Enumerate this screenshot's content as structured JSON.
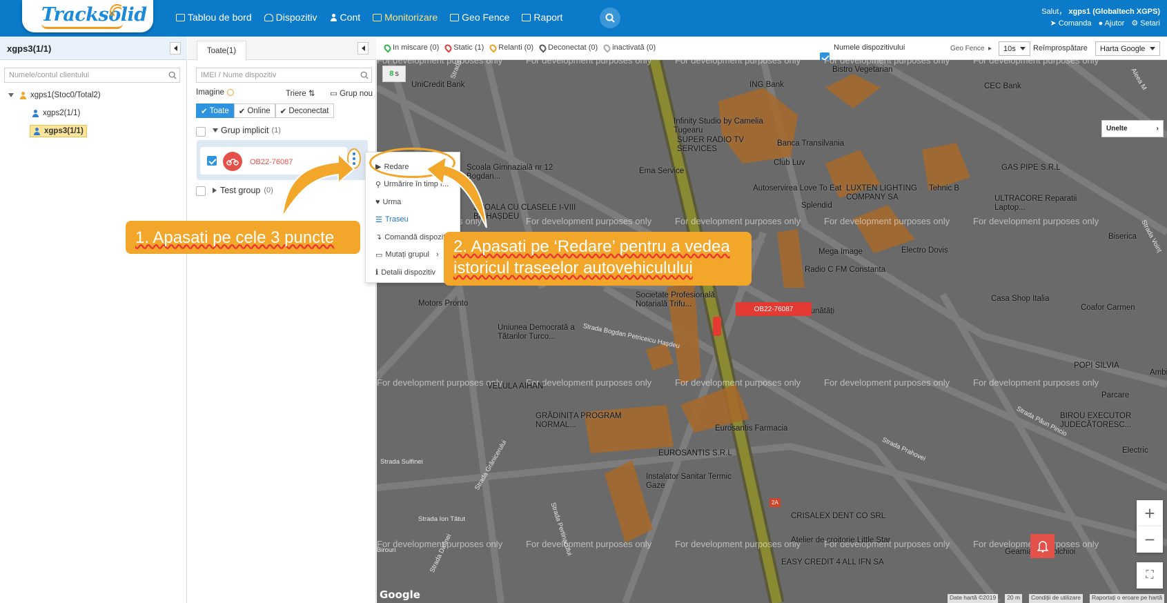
{
  "header": {
    "logo_text": "Tracksolid",
    "nav": [
      {
        "label": "Tablou de bord",
        "icon": "dashboard-icon"
      },
      {
        "label": "Dispozitiv",
        "icon": "device-icon"
      },
      {
        "label": "Cont",
        "icon": "account-icon"
      },
      {
        "label": "Monitorizare",
        "icon": "map-icon",
        "active": true
      },
      {
        "label": "Geo Fence",
        "icon": "geofence-icon"
      },
      {
        "label": "Raport",
        "icon": "report-icon"
      }
    ],
    "greeting": "Salut，",
    "user": "xgps1 (Globaltech XGPS)",
    "links": [
      "Comanda",
      "Ajutor",
      "Setari"
    ]
  },
  "left_panel": {
    "title": "xgps3(1/1)",
    "search_placeholder": "Numele/contul clientului",
    "tree": [
      "xgps1(Stoc0/Total2)",
      "xgps2(1/1)",
      "xgps3(1/1)"
    ]
  },
  "device_panel": {
    "tab": "Toate(1)",
    "search_placeholder": "IMEI / Nume dispozitiv",
    "image_label": "Imagine",
    "sort_label": "Triere",
    "new_group": "Grup nou",
    "filters": [
      "Toate",
      "Online",
      "Deconectat"
    ],
    "groups": [
      {
        "name": "Grup implicit",
        "count": "(1)"
      },
      {
        "name": "Test group",
        "count": "(0)"
      }
    ],
    "device_name": "OB22-76087"
  },
  "context_menu": [
    "Redare",
    "Urmărire în timp r...",
    "Urma",
    "Traseu",
    "Comandă dispoziti",
    "Mutați grupul",
    "Detalii dispozitiv"
  ],
  "map_top": {
    "statuses": [
      {
        "label": "In miscare (0)",
        "color": "#2fb54a"
      },
      {
        "label": "Static (1)",
        "color": "#e33a33"
      },
      {
        "label": "Relanti (0)",
        "color": "#f0a020"
      },
      {
        "label": "Deconectat (0)",
        "color": "#555555"
      },
      {
        "label": "inactivată (0)",
        "color": "#aaaaaa"
      }
    ],
    "device_names_label": "Numele dispozitivului",
    "geofence_label": "Geo Fence",
    "refresh_value": "10s",
    "refresh_label": "Reîmprospătare",
    "map_type": "Harta Google"
  },
  "map": {
    "timer": "8",
    "timer_unit": "s",
    "tools": "Unelte",
    "watermark": "For development purposes only",
    "device_label": "OB22-76087",
    "places": [
      "UniCredit Bank",
      "ING Bank",
      "CEC Bank",
      "Bistro Vegetarian",
      "Infinity Studio by Camelia Tugearu",
      "SUPER RADIO TV SERVICES",
      "Banca Transilvania",
      "Club Luv",
      "Ema Service",
      "Autoservirea Love To Eat",
      "Splendid",
      "LUXTEN LIGHTING COMPANY SA",
      "Tehnic B",
      "GAS PIPE S.R.L",
      "ULTRACORE Reparatii Laptop...",
      "Biserica",
      "Școala Gimnazială nr 12 Bogdan...",
      "ȘCOALA CU CLASELE I-VIII BP HAȘDEU",
      "Mega Image",
      "Electro Dovis",
      "Radio C FM Constanta",
      "Societate Profesională Notarială Trifu...",
      "Vitrina cu Bunătăți",
      "Casa Shop Italia",
      "Coafor Carmen",
      "Motors Pronto",
      "Uniunea Democrată a Tătarilor Turco...",
      "POPI SILVIA",
      "VELULA AIHAN",
      "Parcare",
      "GRĂDINIȚA PROGRAM NORMAL...",
      "Eurosantis Farmacia",
      "BIROU EXECUTOR JUDECĂTORESC...",
      "EUROSANTIS S.R.L",
      "Instalator Sanitar Termic Gaze",
      "CRISALEX DENT CO SRL",
      "Atelier de croitorie Little Star",
      "EASY CREDIT 4 ALL IFN SA",
      "Geamia Anadolchioi",
      "Electric",
      "Ambi"
    ],
    "streets": [
      "Strada Duiliu Zamfirescu",
      "Strada Bogdan Petriceicu Hașdeu",
      "Strada Sulfinei",
      "Strada Grânicerului",
      "Strada Ion Tătut",
      "Strada Pertinacului",
      "Strada Prahovei",
      "Strada Păun Pincio",
      "Aleea M",
      "Strada Voinț",
      "Strada Dafinei",
      "Birouri"
    ],
    "footer": [
      "Date hartă ©2019",
      "20 m",
      "Condiții de utilizare",
      "Raportați o eroare pe hartă"
    ],
    "road_badge": "2A",
    "google": "Google"
  },
  "callouts": {
    "step1": "1. Apasati pe cele 3 puncte",
    "step2_line1": "2. Apasati pe ‘Redare’ pentru a vedea",
    "step2_line2": "istoricul traseelor autovehiculului"
  },
  "colors": {
    "brand": "#0a7ac9",
    "accent": "#f2a62a",
    "alert": "#e33a33"
  }
}
